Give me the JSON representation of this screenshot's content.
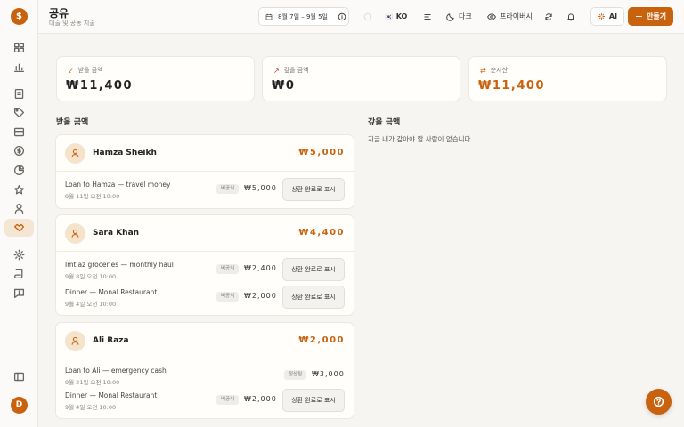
{
  "app": {
    "logo_glyph": "$",
    "user_initial": "D",
    "accent": "#c9620e"
  },
  "header": {
    "title": "공유",
    "subtitle": "대출 및 공동 지출",
    "date_range": "8월 7일 – 9월 5일",
    "language": "KO",
    "language_flag": "🇰🇷",
    "theme_label": "다크",
    "privacy_label": "프라이버시",
    "ai_label": "AI",
    "create_label": "만들기"
  },
  "stats": [
    {
      "label": "받을 금액",
      "arrow": "↙",
      "value": "₩11,400"
    },
    {
      "label": "갚을 금액",
      "arrow": "↗",
      "value": "₩0"
    },
    {
      "label": "순자산",
      "arrow": "⇄",
      "value": "₩11,400"
    }
  ],
  "sections": {
    "receivable_title": "받을 금액",
    "payable_title": "갚을 금액",
    "payable_empty": "지금 내가 갚아야 할 사람이 없습니다."
  },
  "people": [
    {
      "name": "Hamza Sheikh",
      "total": "₩5,000",
      "entries": [
        {
          "title": "Loan to Hamza — travel money",
          "date": "9월 11일 오전 10:00",
          "badge": "비공식",
          "amount": "₩5,000",
          "action": "상환 완료로 표시"
        }
      ]
    },
    {
      "name": "Sara Khan",
      "total": "₩4,400",
      "entries": [
        {
          "title": "Imtiaz groceries — monthly haul",
          "date": "9월 8일 오전 10:00",
          "badge": "비공식",
          "amount": "₩2,400",
          "action": "상환 완료로 표시"
        },
        {
          "title": "Dinner — Monal Restaurant",
          "date": "9월 4일 오전 10:00",
          "badge": "비공식",
          "amount": "₩2,000",
          "action": "상환 완료로 표시"
        }
      ]
    },
    {
      "name": "Ali Raza",
      "total": "₩2,000",
      "entries": [
        {
          "title": "Loan to Ali — emergency cash",
          "date": "9월 21일 오전 10:00",
          "badge": "정산됨",
          "amount": "₩3,000",
          "action": ""
        },
        {
          "title": "Dinner — Monal Restaurant",
          "date": "9월 4일 오전 10:00",
          "badge": "비공식",
          "amount": "₩2,000",
          "action": "상환 완료로 표시"
        }
      ]
    }
  ]
}
